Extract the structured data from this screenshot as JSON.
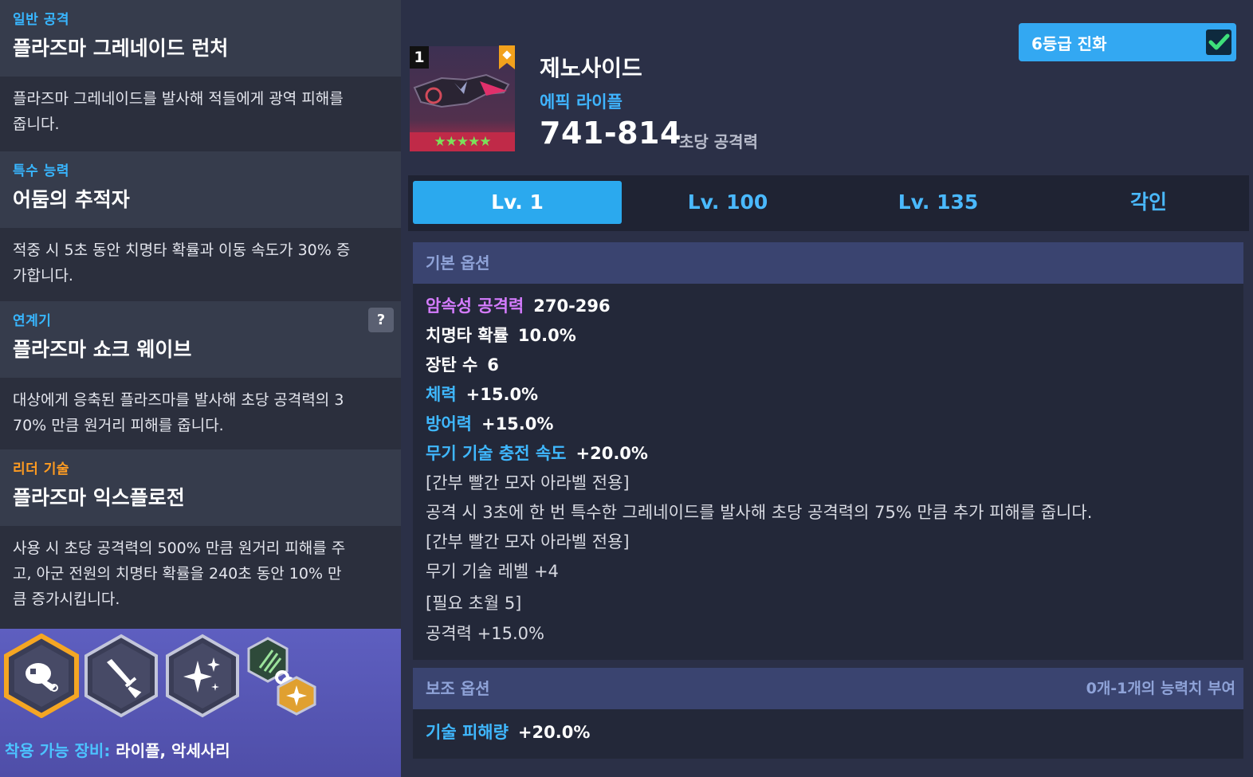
{
  "skills": {
    "normal_attack": {
      "category": "일반 공격",
      "name": "플라즈마 그레네이드 런처",
      "desc_line1": "플라즈마 그레네이드를 발사해 적들에게 광역 피해를",
      "desc_line2": "줍니다."
    },
    "special": {
      "category": "특수 능력",
      "name": "어둠의 추적자",
      "desc_line1": "적중 시 5초 동안 치명타 확률과 이동 속도가 30% 증",
      "desc_line2": "가합니다."
    },
    "chain": {
      "category": "연계기",
      "name": "플라즈마 쇼크 웨이브",
      "help": "?",
      "desc_line1": "대상에게 응축된 플라즈마를 발사해 초당 공격력의 3",
      "desc_line2": "70% 만큼 원거리 피해를 줍니다."
    },
    "leader": {
      "category": "리더 기술",
      "name": "플라즈마 익스플로전",
      "desc_line1": "사용 시 초당 공격력의 500% 만큼 원거리 피해를 주",
      "desc_line2": "고, 아군 전원의 치명타 확률을 240초 동안 10% 만",
      "desc_line3": "큼 증가시킵니다."
    }
  },
  "equip": {
    "label": "착용 가능 장비:",
    "value": "라이플, 악세사리"
  },
  "icons": [
    "grenade-icon",
    "sword-icon",
    "sparkle-icon",
    "claw-icon",
    "star-badge-icon"
  ],
  "weapon": {
    "slot_number": "1",
    "name": "제노사이드",
    "type": "에픽 라이플",
    "damage": "741-814",
    "damage_label": "초당 공격력",
    "stars": "★★★★★"
  },
  "evolve": {
    "label": "6등급 진화",
    "checked": true
  },
  "tabs": [
    {
      "label": "Lv. 1",
      "active": true
    },
    {
      "label": "Lv. 100",
      "active": false
    },
    {
      "label": "Lv. 135",
      "active": false
    },
    {
      "label": "각인",
      "active": false
    }
  ],
  "basic_options": {
    "title": "기본 옵션",
    "rows": {
      "r1": {
        "key": "암속성 공격력",
        "value": "270-296"
      },
      "r2": {
        "key": "치명타 확률",
        "value": "10.0%"
      },
      "r3": {
        "key": "장탄 수",
        "value": "6"
      },
      "r4": {
        "key": "체력",
        "value": "+15.0%"
      },
      "r5": {
        "key": "방어력",
        "value": "+15.0%"
      },
      "r6": {
        "key": "무기 기술 충전 속도",
        "value": "+20.0%"
      },
      "r7": "[간부 빨간 모자 아라벨 전용]",
      "r8": "공격 시 3초에 한 번 특수한 그레네이드를 발사해 초당 공격력의 75% 만큼 추가 피해를 줍니다.",
      "r9": "[간부 빨간 모자 아라벨 전용]",
      "r10": "무기 기술 레벨 +4",
      "r11": "[필요 초월 5]",
      "r12": "공격력 +15.0%"
    }
  },
  "sub_options": {
    "title": "보조 옵션",
    "note": "0개-1개의 능력치 부여",
    "row": {
      "key": "기술 피해량",
      "value": "+20.0%"
    }
  },
  "colors": {
    "accent_blue": "#2ba9ee",
    "leader_orange": "#ff9c21",
    "element_purple": "#d57cff"
  }
}
